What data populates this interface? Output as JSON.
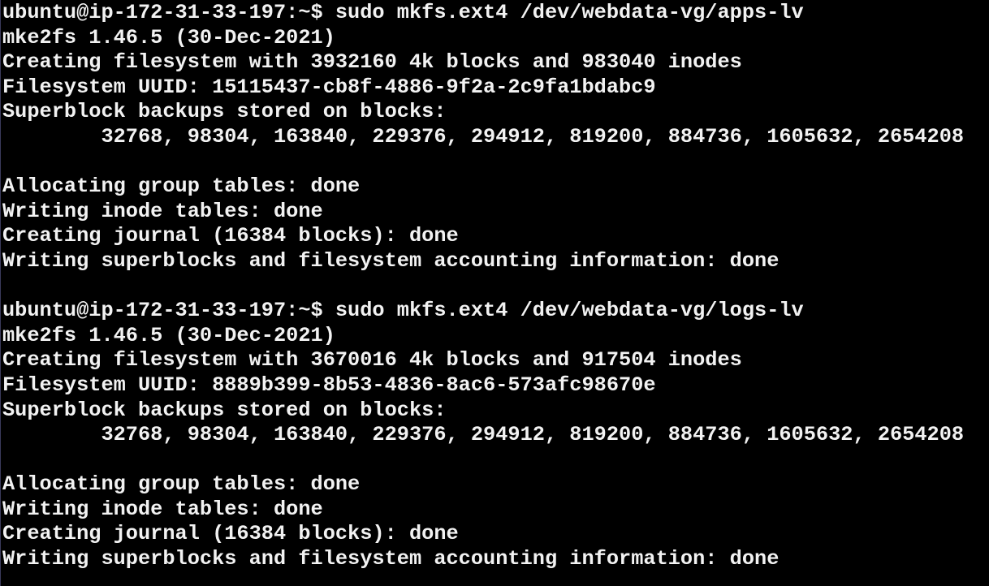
{
  "terminal": {
    "lines": [
      "ubuntu@ip-172-31-33-197:~$ sudo mkfs.ext4 /dev/webdata-vg/apps-lv",
      "mke2fs 1.46.5 (30-Dec-2021)",
      "Creating filesystem with 3932160 4k blocks and 983040 inodes",
      "Filesystem UUID: 15115437-cb8f-4886-9f2a-2c9fa1bdabc9",
      "Superblock backups stored on blocks:",
      "        32768, 98304, 163840, 229376, 294912, 819200, 884736, 1605632, 2654208",
      "",
      "Allocating group tables: done",
      "Writing inode tables: done",
      "Creating journal (16384 blocks): done",
      "Writing superblocks and filesystem accounting information: done",
      "",
      "ubuntu@ip-172-31-33-197:~$ sudo mkfs.ext4 /dev/webdata-vg/logs-lv",
      "mke2fs 1.46.5 (30-Dec-2021)",
      "Creating filesystem with 3670016 4k blocks and 917504 inodes",
      "Filesystem UUID: 8889b399-8b53-4836-8ac6-573afc98670e",
      "Superblock backups stored on blocks:",
      "        32768, 98304, 163840, 229376, 294912, 819200, 884736, 1605632, 2654208",
      "",
      "Allocating group tables: done",
      "Writing inode tables: done",
      "Creating journal (16384 blocks): done",
      "Writing superblocks and filesystem accounting information: done"
    ]
  }
}
